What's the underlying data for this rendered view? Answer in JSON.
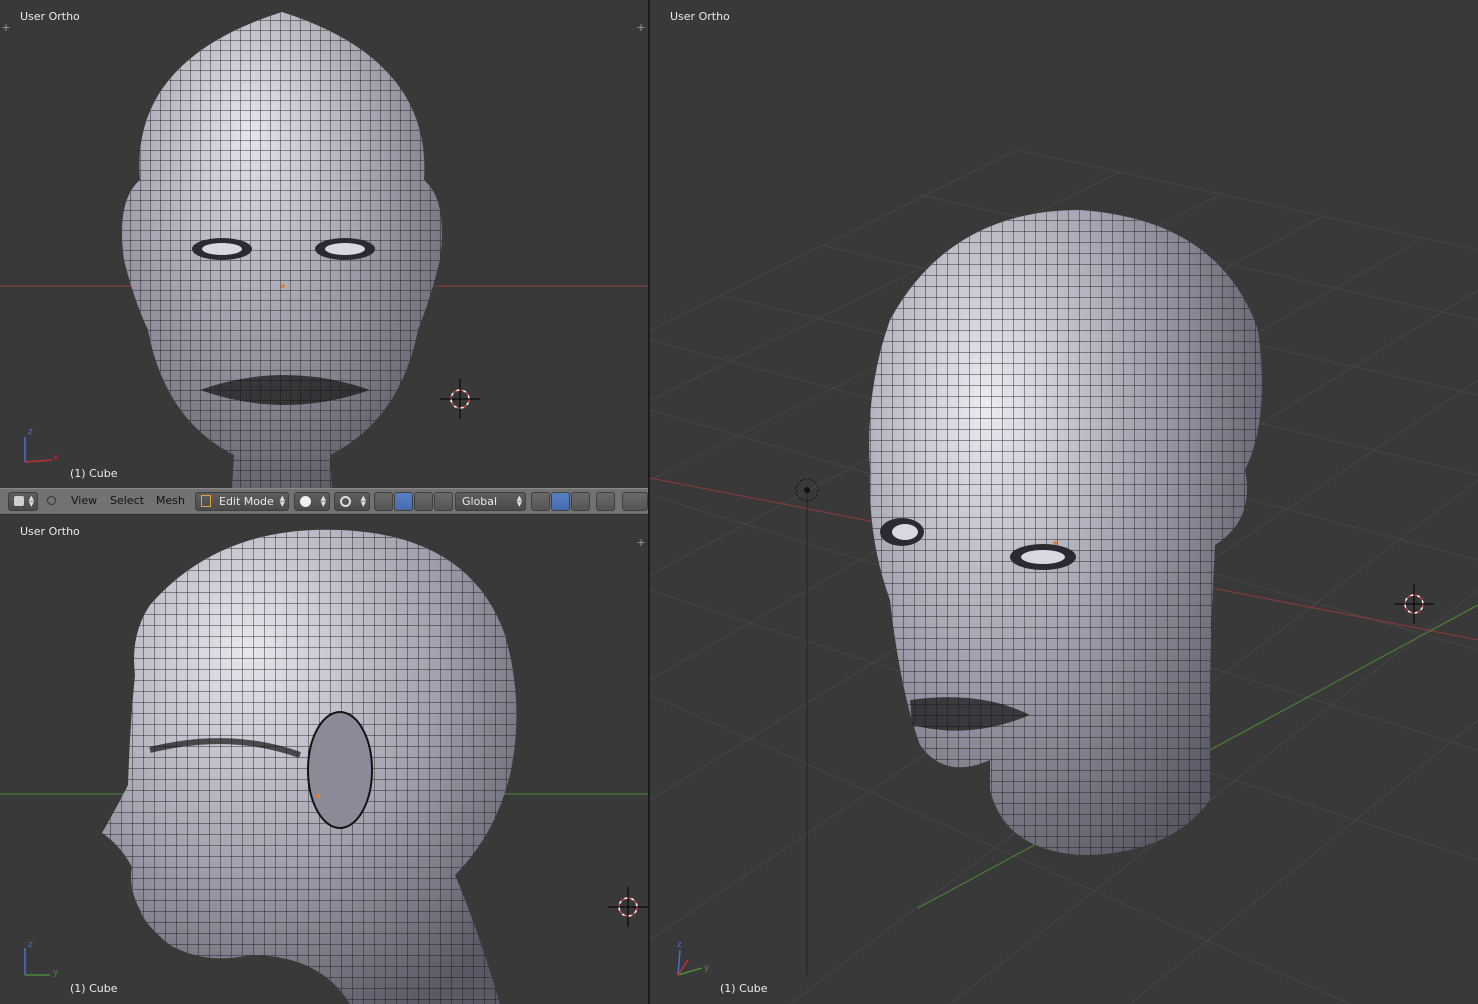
{
  "viewports": {
    "top_left": {
      "view_name": "User Ortho",
      "object_label": "(1) Cube"
    },
    "bottom_left": {
      "view_name": "User Ortho",
      "object_label": "(1) Cube"
    },
    "right": {
      "view_name": "User Ortho",
      "object_label": "(1) Cube"
    }
  },
  "header": {
    "menus": {
      "view": "View",
      "select": "Select",
      "mesh": "Mesh"
    },
    "mode": "Edit Mode",
    "orientation": "Global"
  },
  "colors": {
    "viewport_bg": "#393939",
    "grid": "#464646",
    "x_axis": "#8e3a3a",
    "y_axis": "#4a8a3a",
    "mesh_fill": "#9d9dab",
    "wire": "#101010",
    "header_bg": "#727272",
    "accent": "#5680c2"
  },
  "icons": [
    "editor-type-icon",
    "collapse-icon",
    "mode-icon",
    "shading-icon",
    "pivot-icon",
    "manipulator-icon",
    "translate-icon",
    "rotate-icon",
    "scale-icon",
    "vertex-select-icon",
    "edge-select-icon",
    "face-select-icon",
    "limit-selection-icon",
    "proportional-icon",
    "3d-cursor-icon",
    "lamp-icon",
    "axis-gizmo-icon"
  ]
}
